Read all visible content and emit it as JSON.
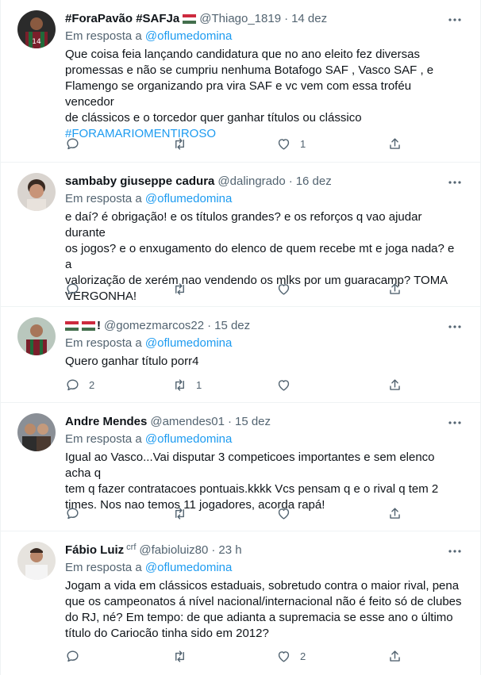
{
  "colors": {
    "accent": "#1d9bf0",
    "secondary_text": "#536471",
    "primary_text": "#0f1419",
    "divider": "#eff3f4"
  },
  "tweets": [
    {
      "name": "#ForaPavão #SAFJa",
      "handle": "@Thiago_1819",
      "date": "14 dez",
      "replying_prefix": "Em resposta a ",
      "replying_to": "@oflumedomina",
      "text": "Que coisa feia lançando candidatura que no ano eleito fez diversas\npromessas e não se cumpriu nenhuma Botafogo SAF , Vasco SAF , e\nFlamengo se organizando pra vira SAF e vc vem com essa troféu vencedor\nde clássicos e o torcedor quer ganhar títulos ou clássico",
      "hashtag": "#FORAMARIOMENTIROSO",
      "replies": "",
      "retweets": "",
      "likes": "1"
    },
    {
      "name": "sambaby giuseppe cadura",
      "handle": "@dalingrado",
      "date": "16 dez",
      "replying_prefix": "Em resposta a ",
      "replying_to": "@oflumedomina",
      "text": "e daí? é obrigação! e os títulos grandes? e os reforços q vao ajudar durante\nos jogos? e o enxugamento do elenco de quem recebe mt e joga nada? e a\nvalorização de xerém nao vendendo os mlks por um guaracamp? TOMA\nVERGONHA!",
      "replies": "",
      "retweets": "",
      "likes": ""
    },
    {
      "name": "!",
      "handle": "@gomezmarcos22",
      "date": "15 dez",
      "replying_prefix": "Em resposta a ",
      "replying_to": "@oflumedomina",
      "text": "Quero ganhar título porr4",
      "replies": "2",
      "retweets": "1",
      "likes": ""
    },
    {
      "name": "Andre Mendes",
      "handle": "@amendes01",
      "date": "15 dez",
      "replying_prefix": "Em resposta a ",
      "replying_to": "@oflumedomina",
      "text": "Igual ao Vasco...Vai disputar 3 competicoes importantes e sem elenco acha q\ntem q fazer contratacoes pontuais.kkkk Vcs pensam q e o rival q tem 2\ntimes. Nos nao temos 11 jogadores, acorda rapá!",
      "replies": "",
      "retweets": "",
      "likes": ""
    },
    {
      "name": "Fábio Luiz",
      "name_extra": "crf",
      "handle": "@fabioluiz80",
      "date": "23 h",
      "replying_prefix": "Em resposta a ",
      "replying_to": "@oflumedomina",
      "text": "Jogam a vida em clássicos estaduais, sobretudo contra o maior rival, pena\nque os campeonatos á nível nacional/internacional não é feito só de clubes\ndo RJ, né? Em tempo: de que adianta a supremacia se esse ano o último\ntítulo do Cariocão tinha sido em 2012?",
      "replies": "",
      "retweets": "",
      "likes": "2"
    }
  ]
}
